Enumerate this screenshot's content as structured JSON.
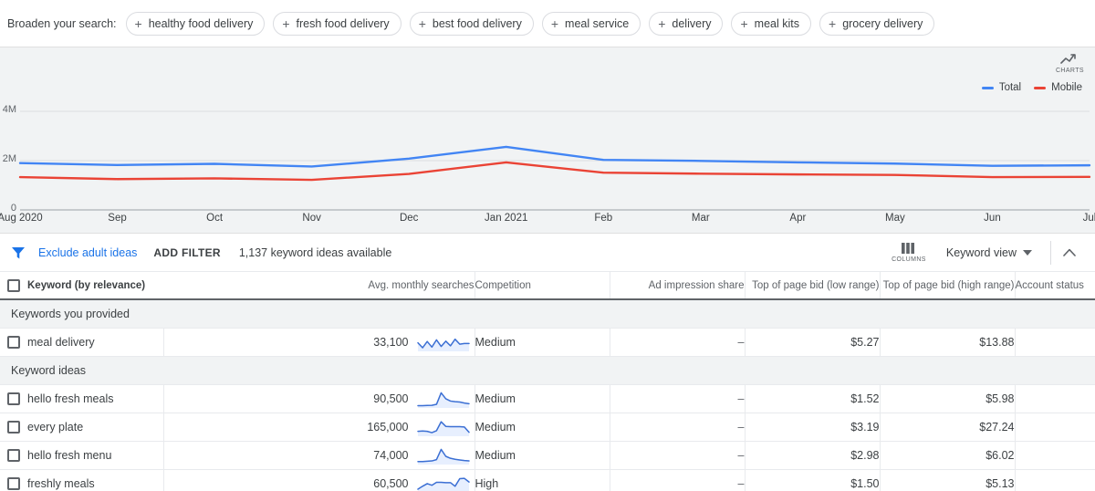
{
  "broaden": {
    "label": "Broaden your search:",
    "chips": [
      "healthy food delivery",
      "fresh food delivery",
      "best food delivery",
      "meal service",
      "delivery",
      "meal kits",
      "grocery delivery"
    ],
    "plus_glyph": "+"
  },
  "chart_panel": {
    "charts_button_label": "CHARTS",
    "charts_icon": "line-chart-icon"
  },
  "chart_data": {
    "type": "line",
    "title": "",
    "xlabel": "",
    "ylabel": "",
    "grid": true,
    "legend_position": "top-right",
    "ylim": [
      0,
      4000000
    ],
    "ytick_labels": [
      "4M",
      "2M",
      "0"
    ],
    "ytick_values": [
      4000000,
      2000000,
      0
    ],
    "x": [
      "Aug 2020",
      "Sep",
      "Oct",
      "Nov",
      "Dec",
      "Jan 2021",
      "Feb",
      "Mar",
      "Apr",
      "May",
      "Jun",
      "Jul"
    ],
    "series": [
      {
        "name": "Total",
        "color": "#4285f4",
        "values": [
          1900000,
          1820000,
          1870000,
          1760000,
          2080000,
          2560000,
          2030000,
          1990000,
          1930000,
          1880000,
          1790000,
          1810000
        ]
      },
      {
        "name": "Mobile",
        "color": "#ea4335",
        "values": [
          1330000,
          1250000,
          1280000,
          1220000,
          1460000,
          1930000,
          1510000,
          1470000,
          1440000,
          1420000,
          1330000,
          1340000
        ]
      }
    ]
  },
  "filter_bar": {
    "filter_icon": "filter-funnel-icon",
    "exclude_adult_ideas": "Exclude adult ideas",
    "add_filter": "ADD FILTER",
    "ideas_available": "1,137 keyword ideas available",
    "columns_label": "COLUMNS",
    "columns_icon": "columns-icon",
    "keyword_view": "Keyword view",
    "dropdown_icon": "chevron-down-icon",
    "collapse_icon": "chevron-up-icon"
  },
  "table": {
    "columns": [
      "Keyword (by relevance)",
      "Avg. monthly searches",
      "Competition",
      "Ad impression share",
      "Top of page bid (low range)",
      "Top of page bid (high range)",
      "Account status"
    ],
    "groups": [
      {
        "title": "Keywords you provided",
        "rows": [
          {
            "keyword": "meal delivery",
            "avg_monthly_searches": "33,100",
            "competition": "Medium",
            "ad_impression_share": "–",
            "bid_low": "$5.27",
            "bid_high": "$13.88",
            "account_status": "",
            "sparkline": [
              52,
              22,
              60,
              26,
              70,
              30,
              62,
              34,
              74,
              44,
              48,
              48
            ]
          }
        ]
      },
      {
        "title": "Keyword ideas",
        "rows": [
          {
            "keyword": "hello fresh meals",
            "avg_monthly_searches": "90,500",
            "competition": "Medium",
            "ad_impression_share": "–",
            "bid_low": "$1.52",
            "bid_high": "$5.98",
            "account_status": "",
            "sparkline": [
              14,
              14,
              15,
              16,
              22,
              92,
              56,
              42,
              38,
              36,
              30,
              26
            ]
          },
          {
            "keyword": "every plate",
            "avg_monthly_searches": "165,000",
            "competition": "Medium",
            "ad_impression_share": "–",
            "bid_low": "$3.19",
            "bid_high": "$27.24",
            "account_status": "",
            "sparkline": [
              30,
              32,
              30,
              22,
              34,
              88,
              60,
              58,
              58,
              58,
              56,
              24
            ]
          },
          {
            "keyword": "hello fresh menu",
            "avg_monthly_searches": "74,000",
            "competition": "Medium",
            "ad_impression_share": "–",
            "bid_low": "$2.98",
            "bid_high": "$6.02",
            "account_status": "",
            "sparkline": [
              18,
              18,
              20,
              22,
              30,
              92,
              50,
              38,
              32,
              28,
              24,
              22
            ]
          },
          {
            "keyword": "freshly meals",
            "avg_monthly_searches": "60,500",
            "competition": "High",
            "ad_impression_share": "–",
            "bid_low": "$1.50",
            "bid_high": "$5.13",
            "account_status": "",
            "sparkline": [
              22,
              40,
              56,
              46,
              64,
              64,
              62,
              62,
              40,
              86,
              88,
              66
            ]
          }
        ]
      }
    ]
  },
  "colors": {
    "accent_blue": "#1a73e8",
    "series_total": "#4285f4",
    "series_mobile": "#ea4335",
    "panel_bg": "#f1f3f4",
    "border": "#e8eaed"
  }
}
